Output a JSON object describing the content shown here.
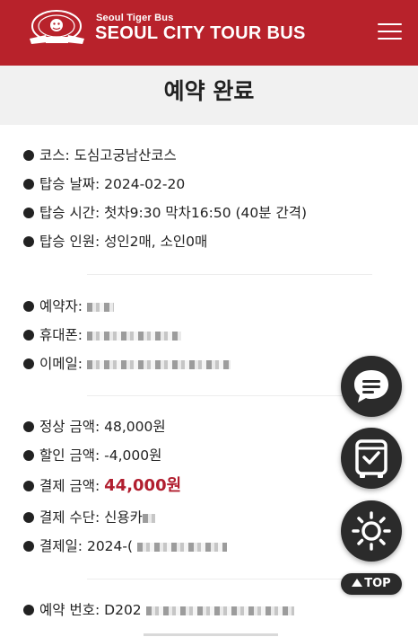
{
  "header": {
    "brand_small": "Seoul Tiger Bus",
    "brand_big": "SEOUL CITY TOUR BUS",
    "logo_icon": "tiger-emblem-icon",
    "menu_icon": "hamburger-menu-icon",
    "bg_color": "#b8222b"
  },
  "page_title": "예약 완료",
  "tour_info": {
    "course_label": "코스:",
    "course_value": "도심고궁남산코스",
    "date_label": "탑승 날짜:",
    "date_value": "2024-02-20",
    "time_label": "탑승 시간:",
    "time_value": "첫차9:30 막차16:50 (40분 간격)",
    "people_label": "탑승 인원:",
    "people_value": "성인2매, 소인0매"
  },
  "booker_info": {
    "name_label": "예약자:",
    "phone_label": "휴대폰:",
    "email_label": "이메일:"
  },
  "payment_info": {
    "regular_label": "정상 금액:",
    "regular_value": "48,000원",
    "discount_label": "할인 금액:",
    "discount_value": "-4,000원",
    "paid_label": "결제 금액:",
    "paid_value": "44,000원",
    "method_label": "결제 수단:",
    "method_value": "신용카",
    "paydate_label": "결제일:",
    "paydate_value": "2024-("
  },
  "reservation": {
    "number_label": "예약 번호:",
    "number_value": "D202"
  },
  "floating": {
    "chat_icon": "chat-bubble-icon",
    "bus_icon": "bus-check-icon",
    "theme_icon": "sun-icon",
    "top_label": "TOP"
  },
  "accent_color": "#b11e2f"
}
